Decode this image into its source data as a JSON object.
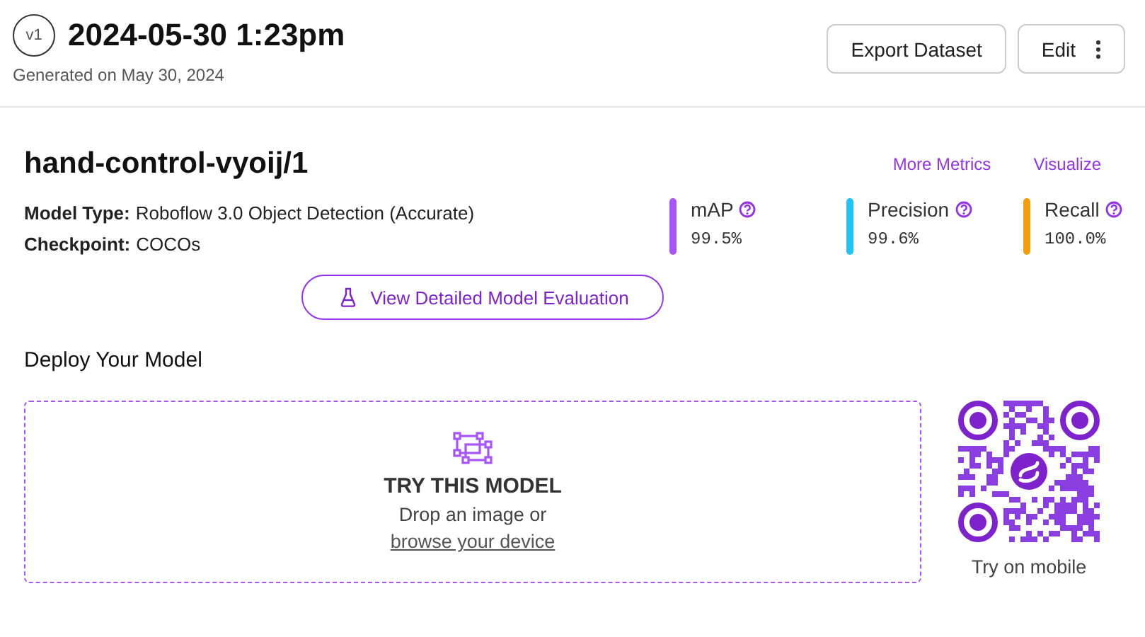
{
  "header": {
    "version_badge": "v1",
    "title": "2024-05-30 1:23pm",
    "subtitle": "Generated on May 30, 2024",
    "buttons": [
      {
        "kind": "plain",
        "label": "Export Dataset"
      },
      {
        "kind": "menu",
        "label": "Edit"
      }
    ]
  },
  "model": {
    "name": "hand-control-vyoij/1",
    "links": [
      "More Metrics",
      "Visualize"
    ],
    "details": [
      {
        "label": "Model Type:",
        "value": "Roboflow 3.0 Object Detection (Accurate)"
      },
      {
        "label": "Checkpoint:",
        "value": "COCOs"
      }
    ],
    "metrics": [
      {
        "name": "mAP",
        "value": "99.5%",
        "color": "#a855f7"
      },
      {
        "name": "Precision",
        "value": "99.6%",
        "color": "#22c3f3"
      },
      {
        "name": "Recall",
        "value": "100.0%",
        "color": "#f59e0b"
      }
    ],
    "evaluation_button": "View Detailed Model Evaluation"
  },
  "deploy": {
    "title": "Deploy Your Model",
    "dropzone": {
      "heading": "TRY THIS MODEL",
      "text": "Drop an image or",
      "link": "browse your device"
    },
    "qr_caption": "Try on mobile"
  }
}
